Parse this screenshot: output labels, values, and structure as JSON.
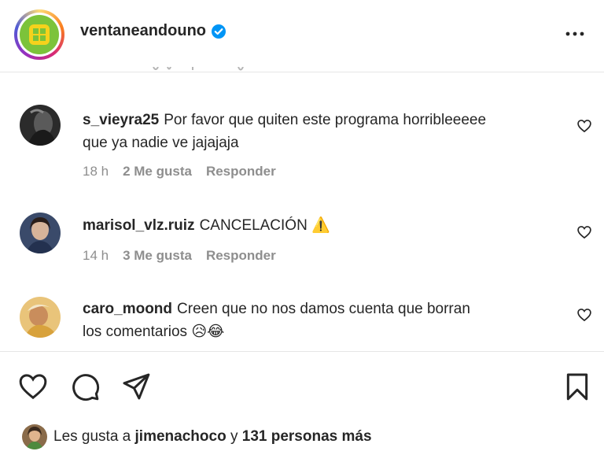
{
  "post": {
    "username": "ventaneandouno",
    "verified": true
  },
  "comments": [
    {
      "username": "s_vieyra25",
      "text_line1": "Por favor que quiten este programa horribleeeee",
      "text_line2": "que ya nadie ve jajajaja",
      "time": "18 h",
      "likes": "2 Me gusta",
      "reply": "Responder"
    },
    {
      "username": "marisol_vlz.ruiz",
      "text_line1": "CANCELACIÓN ⚠️",
      "time": "14 h",
      "likes": "3 Me gusta",
      "reply": "Responder"
    },
    {
      "username": "caro_moond",
      "text_line1": "Creen que no nos damos cuenta que borran",
      "text_line2": "los comentarios 😥😂"
    }
  ],
  "likes_summary": {
    "prefix": "Les gusta a",
    "user": "jimenachoco",
    "connector": "y",
    "others": "131 personas más"
  },
  "colors": {
    "text": "#262626",
    "muted": "#8e8e8e",
    "verified": "#0095f6",
    "logo_green": "#7cc33a"
  },
  "icons": [
    "verified-badge-icon",
    "more-options-icon",
    "heart-icon",
    "comment-icon",
    "share-icon",
    "bookmark-icon"
  ]
}
